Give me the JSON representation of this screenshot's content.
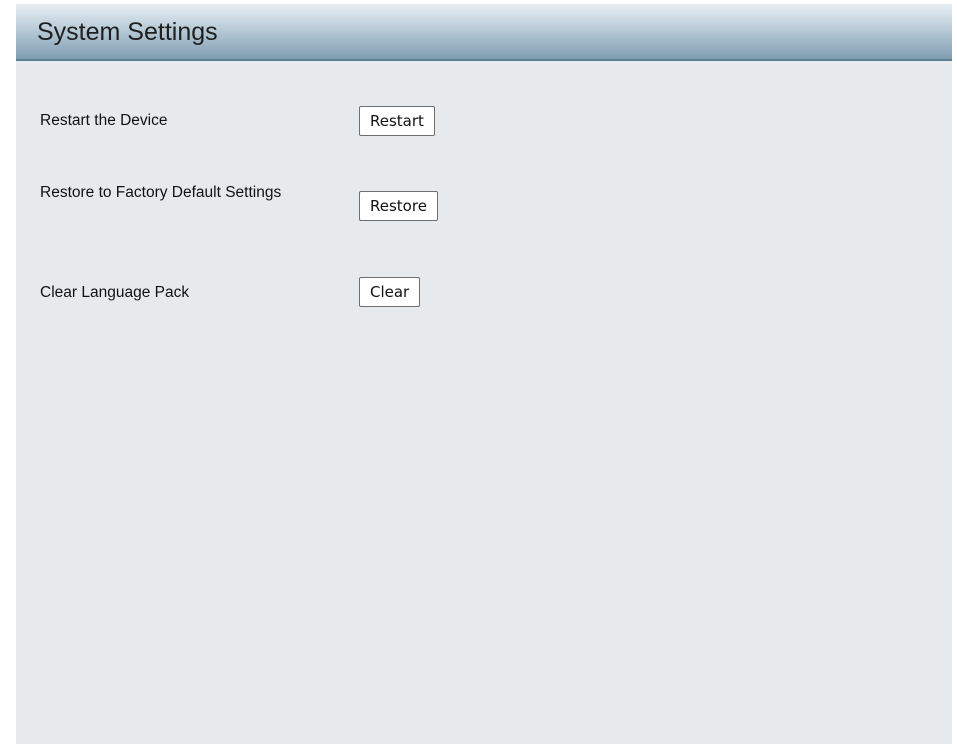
{
  "header": {
    "title": "System Settings"
  },
  "settings": [
    {
      "label": "Restart the Device",
      "button": "Restart"
    },
    {
      "label": "Restore to Factory Default Settings",
      "button": "Restore"
    },
    {
      "label": "Clear Language Pack",
      "button": "Clear"
    }
  ]
}
